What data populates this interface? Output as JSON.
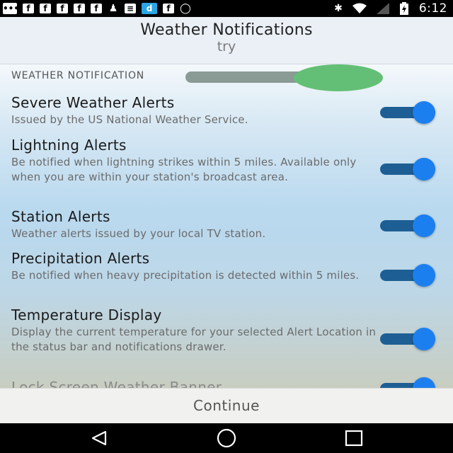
{
  "status_bar": {
    "time": "6:12",
    "left_icons": [
      "chat-icon",
      "facebook-icon",
      "facebook-icon",
      "facebook-icon",
      "facebook-icon",
      "facebook-icon",
      "figure-icon",
      "message-icon",
      "d-app-icon",
      "facebook-icon",
      "circle-icon"
    ],
    "right_icons": [
      "bluetooth-icon",
      "wifi-icon",
      "signal-icon",
      "battery-charging-icon"
    ]
  },
  "header": {
    "title": "Weather Notifications",
    "subtitle": "try"
  },
  "section": {
    "label": "WEATHER NOTIFICATION"
  },
  "items": [
    {
      "title": "Severe Weather Alerts",
      "description": "Issued by the US National Weather Service.",
      "enabled": true
    },
    {
      "title": "Lightning Alerts",
      "description": "Be notified when lightning strikes within 5 miles. Available only when you are within your station's broadcast area.",
      "enabled": true
    },
    {
      "title": "Station Alerts",
      "description": "Weather alerts issued by your local TV station.",
      "enabled": true
    },
    {
      "title": "Precipitation Alerts",
      "description": "Be notified when heavy precipitation is detected within 5 miles.",
      "enabled": true
    },
    {
      "title": "Temperature Display",
      "description": "Display the current temperature for your selected Alert Location in the status bar and notifications drawer.",
      "enabled": true
    },
    {
      "title": "Lock Screen Weather Banner",
      "description": "",
      "enabled": true
    }
  ],
  "footer": {
    "continue_label": "Continue"
  },
  "colors": {
    "toggle_track": "#1d5f94",
    "toggle_thumb": "#1b7ff0",
    "highlight_blob": "#63bf75"
  }
}
